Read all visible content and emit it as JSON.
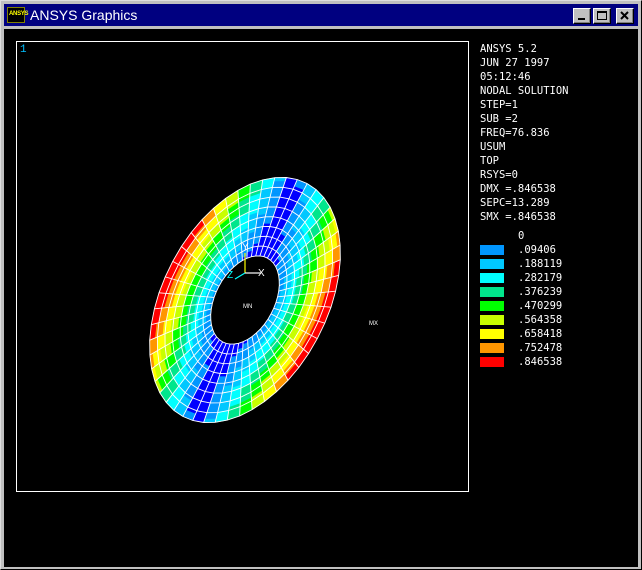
{
  "window": {
    "title": "ANSYS Graphics",
    "icon_label": "ANSYS",
    "icon_name": "ansys-app-icon",
    "controls": [
      "minimize-icon",
      "maximize-icon",
      "close-icon"
    ]
  },
  "viewport": {
    "window_number": "1",
    "triad": {
      "y_label": "Y",
      "z_label": "Z",
      "x_label": "X"
    },
    "mn_marker": "MN",
    "mx_marker": "MX"
  },
  "info_lines": [
    "ANSYS 5.2",
    "JUN 27 1997",
    "05:12:46",
    "NODAL SOLUTION",
    "STEP=1",
    "SUB =2",
    "FREQ=76.836",
    "USUM",
    "TOP",
    "RSYS=0",
    "DMX =.846538",
    "SEPC=13.289",
    "SMX =.846538"
  ],
  "legend": [
    {
      "label": "0",
      "color": "#0000ff"
    },
    {
      "label": ".09406",
      "color": "#0096ff"
    },
    {
      "label": ".188119",
      "color": "#00c8ff"
    },
    {
      "label": ".282179",
      "color": "#00ffff"
    },
    {
      "label": ".376239",
      "color": "#00e68c"
    },
    {
      "label": ".470299",
      "color": "#00ff00"
    },
    {
      "label": ".564358",
      "color": "#c8ff00"
    },
    {
      "label": ".658418",
      "color": "#ffff00"
    },
    {
      "label": ".752478",
      "color": "#ff9600"
    },
    {
      "label": ".846538",
      "color": "#ff0000"
    }
  ]
}
